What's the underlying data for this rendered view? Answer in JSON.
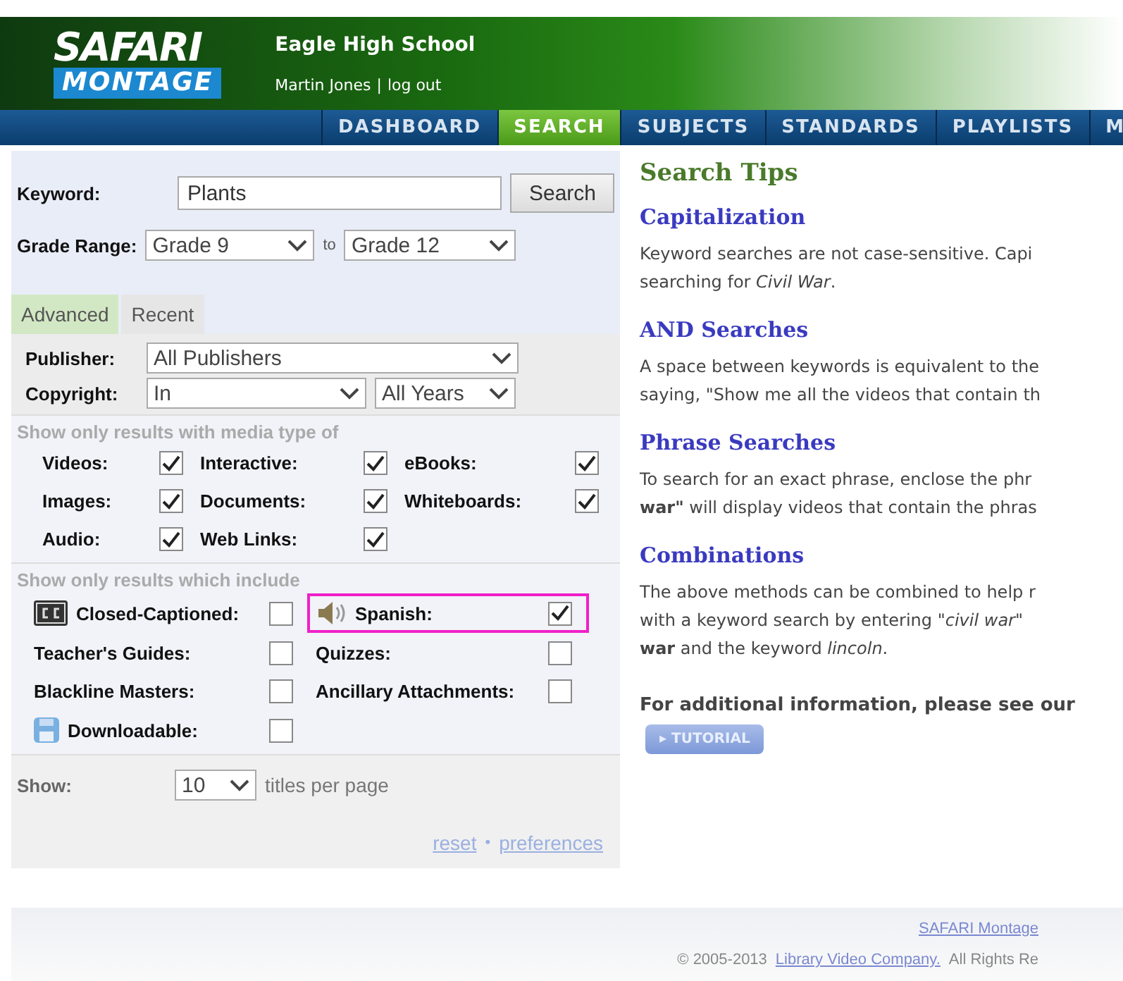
{
  "header": {
    "logo_top": "SAFARI",
    "logo_bottom": "MONTAGE",
    "school": "Eagle High School",
    "user": "Martin Jones",
    "separator": "|",
    "logout": "log out"
  },
  "nav": [
    {
      "label": "DASHBOARD",
      "selected": false
    },
    {
      "label": "SEARCH",
      "selected": true
    },
    {
      "label": "SUBJECTS",
      "selected": false
    },
    {
      "label": "STANDARDS",
      "selected": false
    },
    {
      "label": "PLAYLISTS",
      "selected": false
    },
    {
      "label": "M",
      "selected": false
    }
  ],
  "search": {
    "keyword_label": "Keyword:",
    "keyword": "Plants",
    "button": "Search",
    "grade_label": "Grade Range:",
    "grade_from": "Grade 9",
    "to": "to",
    "grade_to": "Grade 12"
  },
  "tabs": [
    {
      "label": "Advanced",
      "selected": true
    },
    {
      "label": "Recent",
      "selected": false
    }
  ],
  "filters": {
    "publisher_label": "Publisher:",
    "publisher": "All Publishers",
    "copyright_label": "Copyright:",
    "copyright": "In",
    "years": "All Years"
  },
  "media_heading": "Show only results with media type of",
  "media_types": [
    {
      "label": "Videos:",
      "checked": true
    },
    {
      "label": "Interactive:",
      "checked": true
    },
    {
      "label": "eBooks:",
      "checked": true
    },
    {
      "label": "Images:",
      "checked": true
    },
    {
      "label": "Documents:",
      "checked": true
    },
    {
      "label": "Whiteboards:",
      "checked": true
    },
    {
      "label": "Audio:",
      "checked": true
    },
    {
      "label": "Web Links:",
      "checked": true
    }
  ],
  "include_heading": "Show only results which include",
  "include": [
    {
      "label": "Closed-Captioned:",
      "kind": "captioned",
      "checked": false,
      "highlighted": false
    },
    {
      "label": "Spanish:",
      "kind": "audio",
      "checked": true,
      "highlighted": true
    },
    {
      "label": "Teacher's Guides:",
      "kind": "plain",
      "checked": false,
      "highlighted": false
    },
    {
      "label": "Quizzes:",
      "kind": "plain",
      "checked": false,
      "highlighted": false
    },
    {
      "label": "Blackline Masters:",
      "kind": "plain",
      "checked": false,
      "highlighted": false
    },
    {
      "label": "Ancillary Attachments:",
      "kind": "plain",
      "checked": false,
      "highlighted": false
    },
    {
      "label": "Downloadable:",
      "kind": "download",
      "checked": false,
      "highlighted": false
    }
  ],
  "show": {
    "label": "Show:",
    "value": "10",
    "suffix": "titles per page",
    "reset": "reset",
    "dot": "•",
    "preferences": "preferences"
  },
  "tips": {
    "title": "Search Tips",
    "sections": [
      {
        "heading": "Capitalization",
        "lines": [
          "Keyword searches are not case-sensitive. Capi",
          "searching for *Civil War*."
        ]
      },
      {
        "heading": "AND Searches",
        "lines": [
          "A space between keywords is equivalent to the",
          "saying, \"Show me all the videos that contain th"
        ]
      },
      {
        "heading": "Phrase Searches",
        "lines": [
          "To search for an exact phrase, enclose the phr",
          "**war\"** will display videos that contain the phras"
        ]
      },
      {
        "heading": "Combinations",
        "lines": [
          "The above methods can be combined to help r",
          "with a keyword search by entering \"*civil war*\"",
          "**war** and the keyword *lincoln*."
        ]
      }
    ],
    "more": "For additional information, please see our",
    "tutorial": "TUTORIAL",
    "tutorial_arrow": "▸"
  },
  "footer": {
    "link": "SAFARI Montage",
    "copyright": "© 2005-2013",
    "company": "Library Video Company.",
    "rights": "All Rights Re"
  }
}
